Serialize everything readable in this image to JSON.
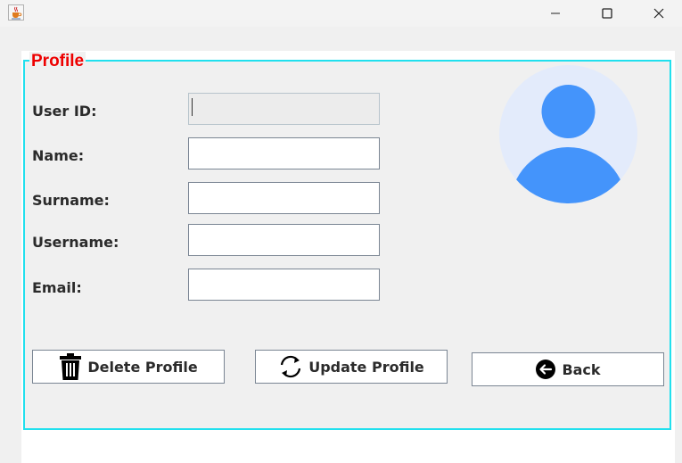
{
  "window": {
    "title": "",
    "icons": {
      "app": "java-cup-icon",
      "minimize": "minimize-icon",
      "maximize": "maximize-icon",
      "close": "close-icon"
    }
  },
  "profile": {
    "legend": "Profile",
    "fields": [
      {
        "label": "User ID:",
        "value": "",
        "editable": false
      },
      {
        "label": "Name:",
        "value": "",
        "editable": true
      },
      {
        "label": "Surname:",
        "value": "",
        "editable": true
      },
      {
        "label": "Username:",
        "value": "",
        "editable": true
      },
      {
        "label": "Email:",
        "value": "",
        "editable": true
      }
    ],
    "avatar_icon": "user-avatar-icon"
  },
  "actions": {
    "delete_label": "Delete Profile",
    "update_label": "Update Profile",
    "back_label": "Back",
    "icons": {
      "delete": "trash-icon",
      "update": "refresh-icon",
      "back": "arrow-left-circle-icon"
    }
  },
  "colors": {
    "legend_text": "#ee0000",
    "frame_border": "#21e0ee",
    "avatar_bg": "#e3ebfb",
    "avatar_fg": "#4494fb"
  }
}
